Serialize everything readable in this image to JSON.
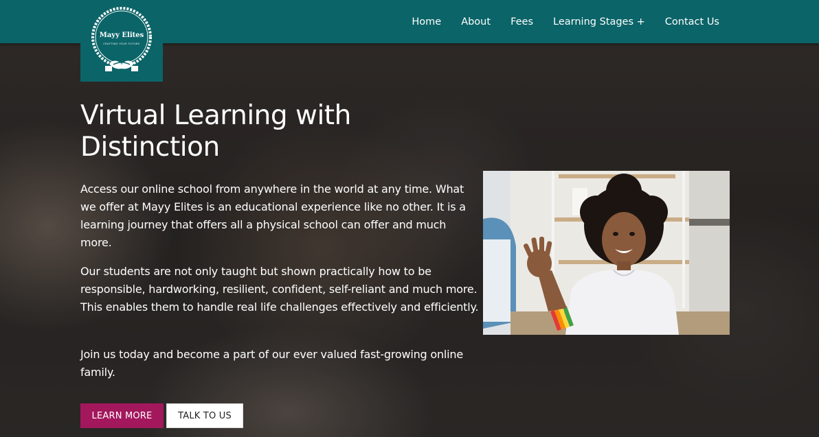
{
  "brand": {
    "name": "Mayy Elites",
    "tagline": "CRAFTING YOUR FUTURE"
  },
  "nav": {
    "items": [
      "Home",
      "About",
      "Fees",
      "Learning Stages +",
      "Contact Us"
    ]
  },
  "hero": {
    "title": "Virtual Learning with Distinction",
    "paragraphs": [
      "Access our online school from anywhere in the world at any time. What we offer at Mayy Elites is an educational experience like no other. It is a learning journey that offers all a physical school can offer and much more.",
      "Our students are not only taught but shown practically how to be responsible, hardworking, resilient, confident, self-reliant and much more. This enables them to handle real life challenges effectively and efficiently.",
      "Join us today and become a part of our ever valued fast-growing online family."
    ],
    "buttons": {
      "learn_more": "LEARN MORE",
      "talk_to_us": "TALK TO US"
    }
  },
  "colors": {
    "header": "#0b6468",
    "accent": "#a3175d",
    "text": "#ffffff"
  }
}
